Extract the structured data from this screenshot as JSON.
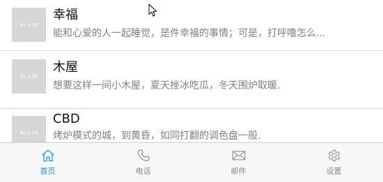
{
  "list": {
    "items": [
      {
        "thumb_text": "40 x 30",
        "title": "幸福",
        "description": "能和心爱的人一起睡觉，是件幸福的事情；可是，打呼噜怎么..."
      },
      {
        "thumb_text": "40 x 30",
        "title": "木屋",
        "description": "想要这样一间小木屋，夏天挫冰吃瓜，冬天围炉取暖."
      },
      {
        "thumb_text": "40 x 30",
        "title": "CBD",
        "description": "烤炉模式的城，到黄昏，如同打翻的调色盘一般."
      }
    ]
  },
  "tabbar": {
    "tabs": [
      {
        "label": "首页",
        "icon": "home-icon",
        "active": true
      },
      {
        "label": "电话",
        "icon": "phone-icon",
        "active": false
      },
      {
        "label": "邮件",
        "icon": "mail-icon",
        "active": false
      },
      {
        "label": "设置",
        "icon": "gear-icon",
        "active": false
      }
    ],
    "active_color": "#1a8ff0",
    "inactive_color": "#888888"
  }
}
